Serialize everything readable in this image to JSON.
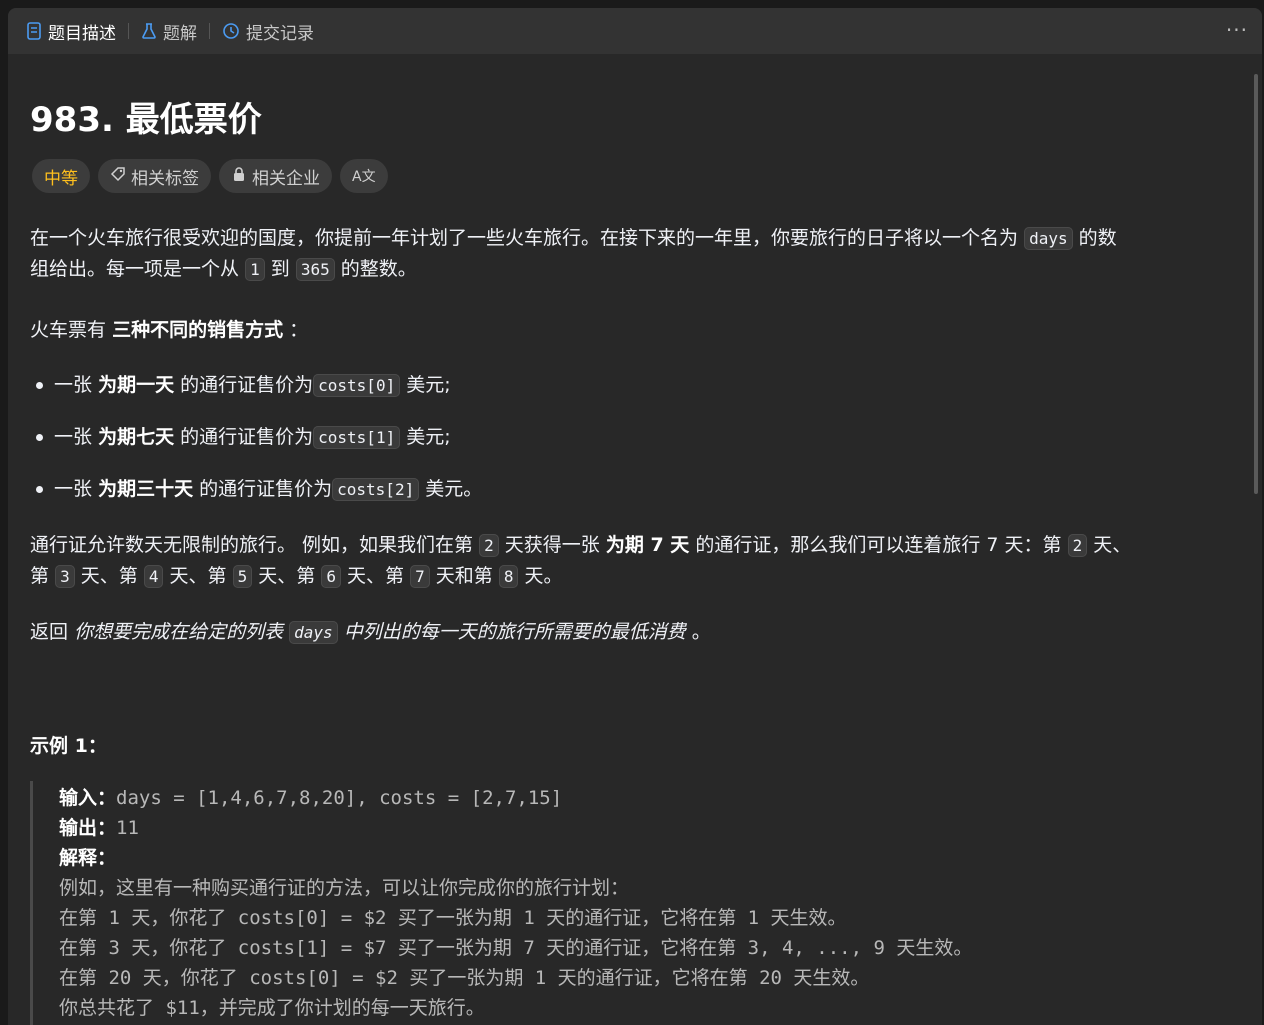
{
  "tabs": [
    {
      "label": "题目描述",
      "icon": "document-icon"
    },
    {
      "label": "题解",
      "icon": "flask-icon"
    },
    {
      "label": "提交记录",
      "icon": "history-icon"
    }
  ],
  "more_label": "···",
  "problem": {
    "title": "983. 最低票价",
    "tags": {
      "difficulty": "中等",
      "related_tags": "相关标签",
      "related_companies": "相关企业",
      "translate": "A文"
    },
    "p1": {
      "a": "在一个火车旅行很受欢迎的国度，你提前一年计划了一些火车旅行。在接下来的一年里，你要旅行的日子将以一个名为",
      "code1": "days",
      "b": "的数",
      "c": "组给出。每一项是一个从",
      "code2": "1",
      "d": "到",
      "code3": "365",
      "e": "的整数。"
    },
    "p2": {
      "a": "火车票有",
      "bold": "三种不同的销售方式",
      "b": "："
    },
    "bullets": [
      {
        "pre": "一张",
        "bold": "为期一天",
        "mid": "的通行证售价为",
        "code": "costs[0]",
        "post": "美元;"
      },
      {
        "pre": "一张",
        "bold": "为期七天",
        "mid": "的通行证售价为",
        "code": "costs[1]",
        "post": "美元;"
      },
      {
        "pre": "一张",
        "bold": "为期三十天",
        "mid": "的通行证售价为",
        "code": "costs[2]",
        "post": "美元。"
      }
    ],
    "p3": {
      "a": "通行证允许数天无限制的旅行。 例如，如果我们在第",
      "c1": "2",
      "b": "天获得一张",
      "bold": "为期 7 天",
      "c": "的通行证，那么我们可以连着旅行 7 天：第",
      "c2": "2",
      "d": "天、",
      "e": "第",
      "c3": "3",
      "f": "天、第",
      "c4": "4",
      "g": "天、第",
      "c5": "5",
      "h": "天、第",
      "c6": "6",
      "i": "天、第",
      "c7": "7",
      "j": "天和第",
      "c8": "8",
      "k": "天。"
    },
    "p4": {
      "a": "返回",
      "i1": "你想要完成在给定的列表",
      "code": "days",
      "i2": "中列出的每一天的旅行所需要的最低消费",
      "b": "。"
    },
    "example": {
      "heading": "示例 1：",
      "input_label": "输入：",
      "input_value": "days = [1,4,6,7,8,20], costs = [2,7,15]",
      "output_label": "输出：",
      "output_value": "11",
      "explain_label": "解释：",
      "lines": [
        "例如，这里有一种购买通行证的方法，可以让你完成你的旅行计划：",
        "在第 1 天，你花了 costs[0] = $2 买了一张为期 1 天的通行证，它将在第 1 天生效。",
        "在第 3 天，你花了 costs[1] = $7 买了一张为期 7 天的通行证，它将在第 3, 4, ..., 9 天生效。",
        "在第 20 天，你花了 costs[0] = $2 买了一张为期 1 天的通行证，它将在第 20 天生效。",
        "你总共花了 $11，并完成了你计划的每一天旅行。"
      ]
    }
  }
}
